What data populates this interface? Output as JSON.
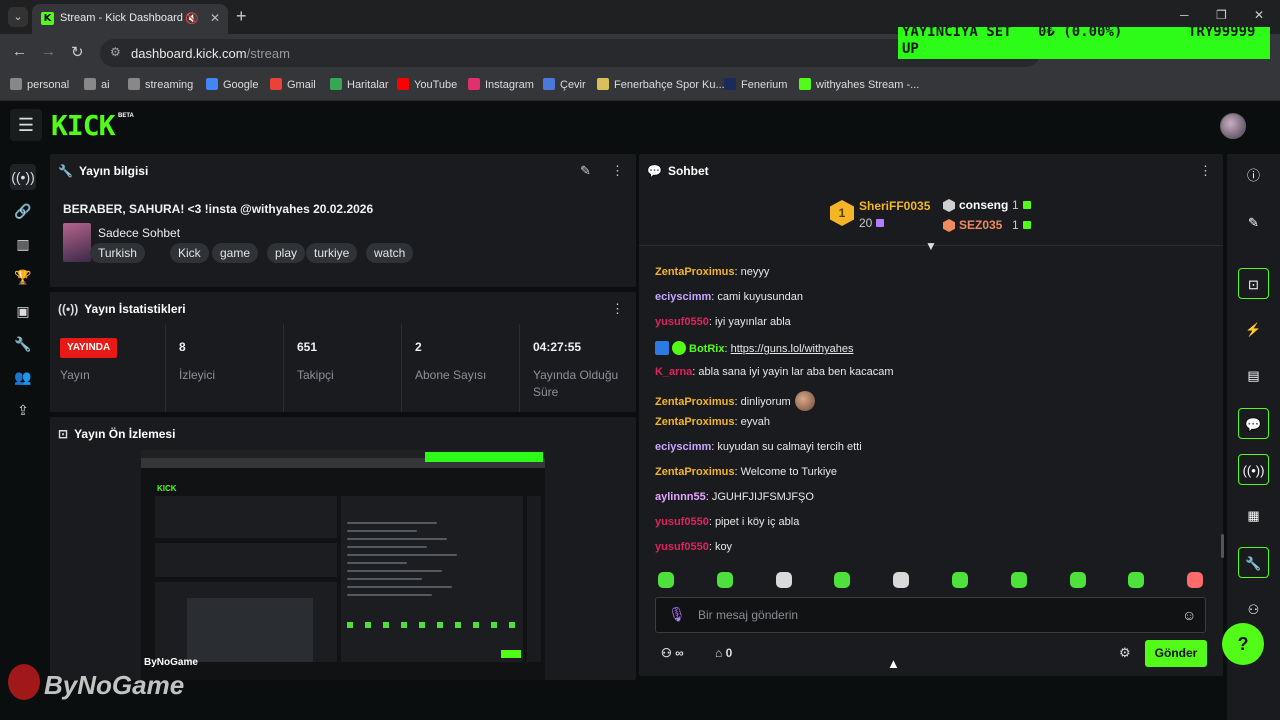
{
  "browser": {
    "tab_title": "Stream - Kick Dashboard",
    "tab_favicon_letter": "K",
    "new_tab_symbol": "+",
    "url_host": "dashboard.kick.com",
    "url_path": "/stream",
    "bookmarks": [
      {
        "label": "personal",
        "color": "#888888"
      },
      {
        "label": "ai",
        "color": "#888888"
      },
      {
        "label": "streaming",
        "color": "#888888"
      },
      {
        "label": "Google",
        "color": "#4285f4"
      },
      {
        "label": "Gmail",
        "color": "#ea4335"
      },
      {
        "label": "Haritalar",
        "color": "#34a853"
      },
      {
        "label": "YouTube",
        "color": "#ff0000"
      },
      {
        "label": "Instagram",
        "color": "#e1306c"
      },
      {
        "label": "Çevir",
        "color": "#4a7ad9"
      },
      {
        "label": "Fenerbahçe Spor Ku...",
        "color": "#d8c15a"
      },
      {
        "label": "Fenerium",
        "color": "#1a2a5a"
      },
      {
        "label": "withyahes Stream -...",
        "color": "#53fc18"
      }
    ]
  },
  "ticker": {
    "part1": "YAYINCIYA SET",
    "part2": "0₺ (0.00%)",
    "part3": "TRY99999",
    "part4": "UP"
  },
  "header": {
    "logo": "KICK",
    "beta": "BETA"
  },
  "info_panel": {
    "title": "Yayın bilgisi",
    "stream_title": "BERABER, SAHURA! <3 !insta @withyahes 20.02.2026",
    "category": "Sadece Sohbet",
    "tags": [
      "Turkish",
      "Kick",
      "game",
      "play",
      "turkiye",
      "watch"
    ]
  },
  "stats_panel": {
    "title": "Yayın İstatistikleri",
    "live_badge": "YAYINDA",
    "live_label": "Yayın",
    "items": [
      {
        "value": "8",
        "label": "İzleyici"
      },
      {
        "value": "651",
        "label": "Takipçi"
      },
      {
        "value": "2",
        "label": "Abone Sayısı"
      },
      {
        "value": "04:27:55",
        "label": "Yayında Olduğu Süre"
      }
    ]
  },
  "preview_panel": {
    "title": "Yayın Ön İzlemesi",
    "watermark_small": "ByNoGame"
  },
  "chat": {
    "title": "Sohbet",
    "leaderboard": {
      "first": {
        "rank": "1",
        "name": "SheriFF0035",
        "count": "20"
      },
      "second": {
        "name": "conseng",
        "count": "1"
      },
      "third": {
        "name": "SEZ035",
        "count": "1"
      }
    },
    "messages": [
      {
        "user": "ZentaProximus",
        "color": "#f4b625",
        "text": "neyyy"
      },
      {
        "user": "eciyscimm",
        "color": "#c9a6ff",
        "text": "cami kuyusundan"
      },
      {
        "user": "yusuf0550",
        "color": "#e0245e",
        "text": "iyi yayınlar abla"
      },
      {
        "user": "BotRix",
        "color": "#53fc18",
        "text": "https://guns.lol/withyahes"
      },
      {
        "user": "K_arna",
        "color": "#e0245e",
        "text": "abla sana iyi yayin lar aba ben kacacam"
      },
      {
        "user": "ZentaProximus",
        "color": "#f4b625",
        "text": "dinliyorum"
      },
      {
        "user": "ZentaProximus",
        "color": "#f4b625",
        "text": "eyvah"
      },
      {
        "user": "eciyscimm",
        "color": "#c9a6ff",
        "text": "kuyudan su calmayi tercih etti"
      },
      {
        "user": "ZentaProximus",
        "color": "#f4b625",
        "text": "Welcome to Turkiye"
      },
      {
        "user": "aylinnn55",
        "color": "#e6a6ff",
        "text": "JGUHFJIJFSMJFŞO"
      },
      {
        "user": "yusuf0550",
        "color": "#e0245e",
        "text": "pipet i köy iç abla"
      },
      {
        "user": "yusuf0550",
        "color": "#e0245e",
        "text": "koy"
      }
    ],
    "input_placeholder": "Bir mesaj gönderin",
    "points_value": "∞",
    "store_value": "0",
    "send_label": "Gönder"
  },
  "watermark": {
    "text": "ByNoGame"
  },
  "colors": {
    "accent": "#53fc18",
    "panel": "#191b1f",
    "background": "#0b0e0f",
    "live": "#e91916"
  }
}
